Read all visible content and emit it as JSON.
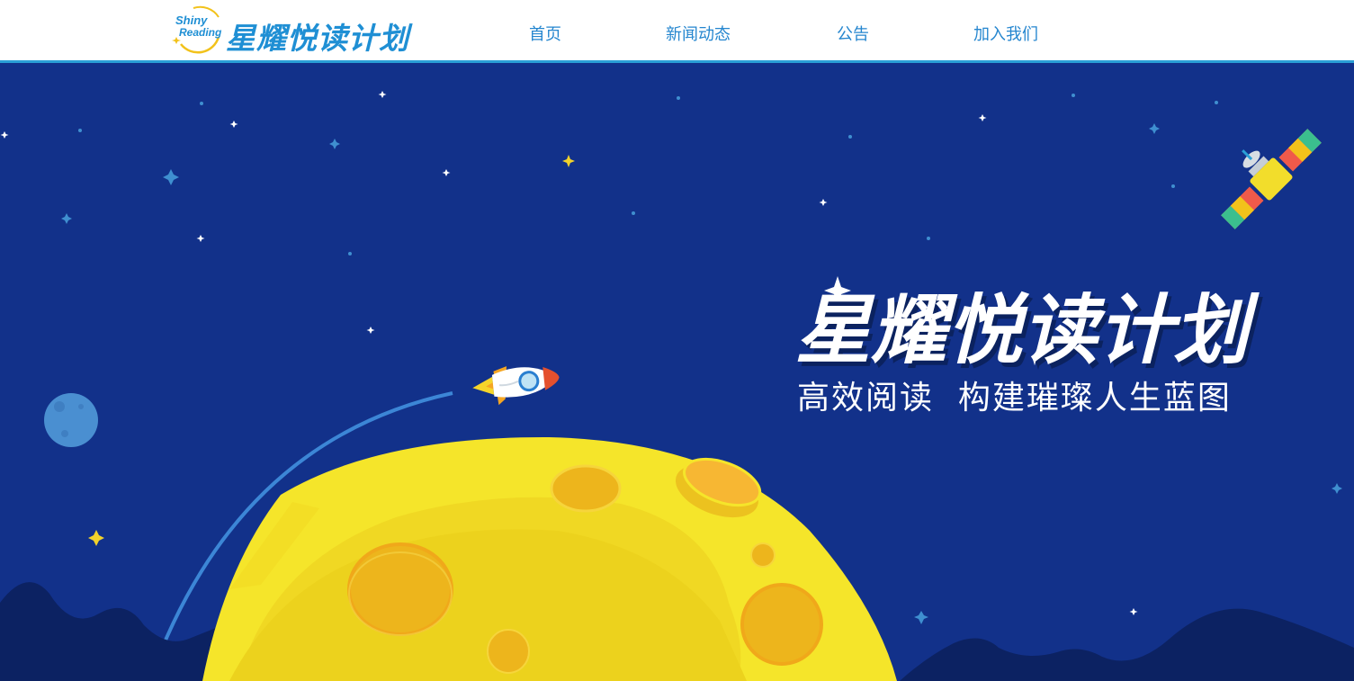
{
  "header": {
    "logo_en_line1": "Shiny",
    "logo_en_line2": "Reading",
    "logo_cn": "星耀悦读计划"
  },
  "nav": {
    "items": [
      {
        "label": "首页"
      },
      {
        "label": "新闻动态"
      },
      {
        "label": "公告"
      },
      {
        "label": "加入我们"
      }
    ]
  },
  "hero": {
    "title": "星耀悦读计划",
    "subtitle": "高效阅读  构建璀璨人生蓝图"
  },
  "colors": {
    "accent": "#2a9fd6",
    "nav_text": "#2586cf",
    "sky": "#12318a",
    "moon": "#f5e52a",
    "crater": "#edb51c"
  }
}
